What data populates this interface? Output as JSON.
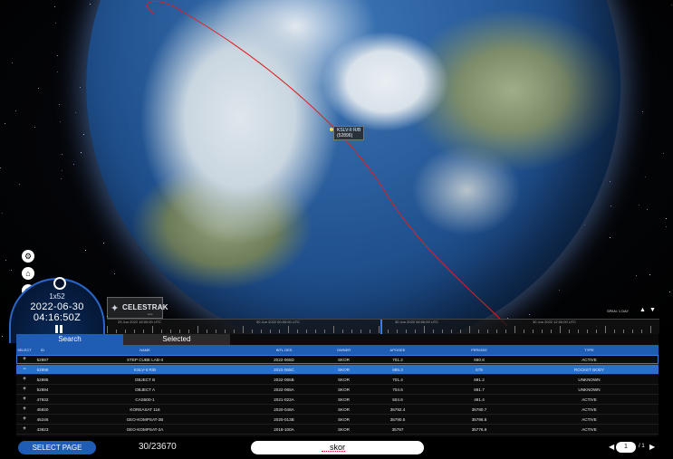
{
  "globe_view": {
    "satellite_label_name": "KSLV-II R/B",
    "satellite_label_id": "(52896)",
    "orbit_color": "#e02020"
  },
  "controls": {
    "settings_icon": "gear-icon",
    "home_icon": "home-icon",
    "clock_icon": "clock-icon"
  },
  "clock": {
    "rate": "1x52",
    "date": "2022-06-30",
    "time": "04:16:50Z",
    "pause_icon": "pause-icon"
  },
  "logo": {
    "mark": "✦",
    "text": "CELESTRAK",
    "sub": "LLC"
  },
  "timeline": {
    "labels": [
      "29 Jun 2022 18:00:00 UTC",
      "30 Jun 2022 00:00:00 UTC",
      "30 Jun 2022 06:00:00 UTC",
      "30 Jun 2022 12:00:00 UTC"
    ],
    "span_label": "SPAN: 1 DAY",
    "span_up": "▲",
    "span_down": "▼"
  },
  "tabs": {
    "search": "Search",
    "selected": "Selected"
  },
  "table": {
    "columns": [
      "SELECT",
      "ID",
      "NAME",
      "INTL DES",
      "OWNER",
      "APOGEE",
      "PERIGEE",
      "TYPE"
    ],
    "rows": [
      {
        "select": "+",
        "id": "52897",
        "name": "STEP CUBE LAB-II",
        "intl": "2022-065D",
        "owner": "SKOR",
        "apogee": "701.2",
        "perigee": "690.8",
        "type": "ACTIVE"
      },
      {
        "select": "−",
        "id": "52896",
        "name": "KSLV-II R/B",
        "intl": "2022-065C",
        "owner": "SKOR",
        "apogee": "685.3",
        "perigee": "679",
        "type": "ROCKET BODY"
      },
      {
        "select": "+",
        "id": "52895",
        "name": "OBJECT B",
        "intl": "2022-065B",
        "owner": "SKOR",
        "apogee": "701.4",
        "perigee": "691.2",
        "type": "UNKNOWN"
      },
      {
        "select": "+",
        "id": "52894",
        "name": "OBJECT A",
        "intl": "2022-065A",
        "owner": "SKOR",
        "apogee": "704.6",
        "perigee": "691.7",
        "type": "UNKNOWN"
      },
      {
        "select": "+",
        "id": "47932",
        "name": "CAS500-1",
        "intl": "2021-022A",
        "owner": "SKOR",
        "apogee": "504.6",
        "perigee": "491.4",
        "type": "ACTIVE"
      },
      {
        "select": "+",
        "id": "45920",
        "name": "KOREASAT 116",
        "intl": "2020-048A",
        "owner": "SKOR",
        "apogee": "35792.4",
        "perigee": "35780.7",
        "type": "ACTIVE"
      },
      {
        "select": "+",
        "id": "45246",
        "name": "GEO-KOMPSAT-2B",
        "intl": "2020-013B",
        "owner": "SKOR",
        "apogee": "35790.5",
        "perigee": "35786.8",
        "type": "ACTIVE"
      },
      {
        "select": "+",
        "id": "43823",
        "name": "GEO-KOMPSAT-2A",
        "intl": "2018-100A",
        "owner": "SKOR",
        "apogee": "35797",
        "perigee": "35776.9",
        "type": "ACTIVE"
      }
    ]
  },
  "footer": {
    "select_page": "SELECT PAGE",
    "count": "30/23670",
    "search_value": "skor",
    "page_prev": "◀",
    "page_current": "1",
    "page_total": "/ 1",
    "page_next": "▶"
  }
}
